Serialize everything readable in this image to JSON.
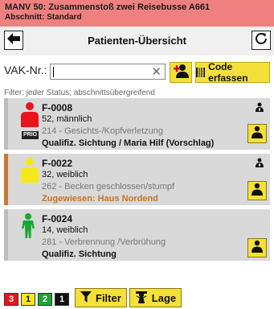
{
  "banner": {
    "title": "MANV 50: Zusammenstoß zwei Reisebusse A661",
    "section": "Abschnitt: Standard"
  },
  "nav": {
    "title": "Patienten-Übersicht",
    "back_icon": "arrow-left-icon",
    "refresh_icon": "refresh-icon"
  },
  "search": {
    "label": "VAK-Nr.:",
    "value": "",
    "clear_symbol": "✕",
    "code_button_label": "Code erfassen"
  },
  "filter_text": "Filter: jeder Status; abschnittsübergreifend",
  "patients": [
    {
      "id": "F-0008",
      "age_sex": "52, männlich",
      "badge": "PRIO",
      "diagnosis": "214 - Gesichts-/Kopfverletzung",
      "status": "Qualifiz. Sichtung / Maria Hilf (Vorschlag)",
      "triage_color": "#e8141a",
      "stripe_color": "#bdbdbd",
      "status_color": "#111111"
    },
    {
      "id": "F-0022",
      "age_sex": "32, weiblich",
      "badge": "",
      "diagnosis": "262 - Becken geschlossen/stumpf",
      "status": "Zugewiesen: Haus Nordend",
      "triage_color": "#f7e81a",
      "stripe_color": "#c87a33",
      "status_color": "#c8741e"
    },
    {
      "id": "F-0024",
      "age_sex": "14, weiblich",
      "badge": "",
      "diagnosis": "281 - Verbrennung /Verbrühung",
      "status": "Qualifiz. Sichtung",
      "triage_color": "#1aa632",
      "stripe_color": "#bdbdbd",
      "status_color": "#111111"
    }
  ],
  "counters": [
    {
      "value": "3",
      "bg": "#e8141a",
      "fg": "#ffffff"
    },
    {
      "value": "1",
      "bg": "#f7e81a",
      "fg": "#111111"
    },
    {
      "value": "2",
      "bg": "#1aa632",
      "fg": "#ffffff"
    },
    {
      "value": "1",
      "bg": "#111111",
      "fg": "#ffffff"
    }
  ],
  "bottom": {
    "filter_label": "Filter",
    "lage_label": "Lage"
  }
}
